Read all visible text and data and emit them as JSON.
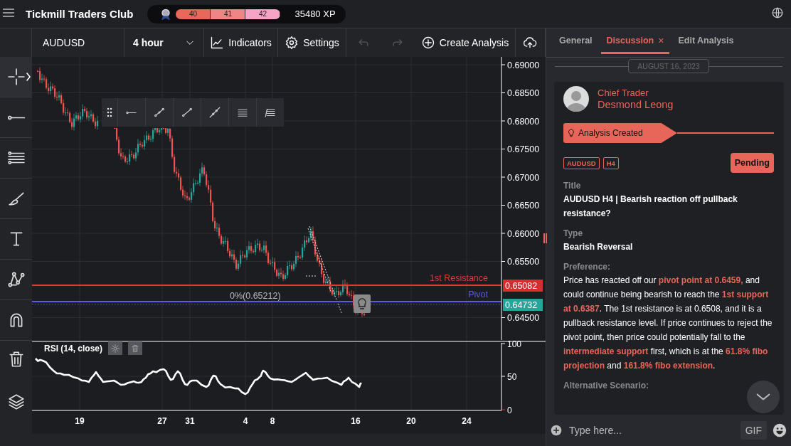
{
  "top_bar": {
    "title": "Tickmill Traders Club",
    "xp_levels": [
      {
        "label": "40",
        "color": "#e8685a"
      },
      {
        "label": "41",
        "color": "#f08585"
      },
      {
        "label": "42",
        "color": "#f6a3c6"
      }
    ],
    "xp": "35480 XP"
  },
  "left_tools": [
    {
      "kind": "crosshair",
      "selected": true
    },
    {
      "kind": "line",
      "selected": false
    },
    {
      "kind": "parallel",
      "selected": false
    },
    {
      "kind": "brush",
      "selected": false
    },
    {
      "kind": "text",
      "selected": false
    },
    {
      "kind": "pattern",
      "selected": false
    },
    {
      "kind": "magnet",
      "selected": false
    },
    {
      "kind": "trash",
      "selected": false
    },
    {
      "kind": "layers",
      "selected": false
    }
  ],
  "toolbar": {
    "symbol": "AUDUSD",
    "interval": "4 hour",
    "buttons": [
      {
        "kind": "indicators",
        "label": "Indicators"
      },
      {
        "kind": "settings",
        "label": "Settings"
      },
      {
        "kind": "undo",
        "disabled": true
      },
      {
        "kind": "redo",
        "disabled": true
      },
      {
        "kind": "create",
        "label": "Create Analysis"
      },
      {
        "kind": "upload"
      }
    ]
  },
  "drawing_toolbar": {
    "tools": [
      {
        "kind": "ray"
      },
      {
        "kind": "segment"
      },
      {
        "kind": "line"
      },
      {
        "kind": "extended"
      },
      {
        "kind": "channel"
      },
      {
        "kind": "fib"
      }
    ]
  },
  "chart": {
    "y_ticks": [
      "0.69000",
      "0.68500",
      "0.68000",
      "0.67500",
      "0.67000",
      "0.66500",
      "0.66000",
      "0.65500",
      "0.64500"
    ],
    "levels": [
      {
        "label": "1st Resistance",
        "color": "#e03a3a"
      },
      {
        "label": "Pivot",
        "color": "#5b5bdc"
      }
    ],
    "price_tags": [
      {
        "label": "0.65082",
        "color": "#d32f2f"
      },
      {
        "label": "0.64732",
        "color": "#26a69a"
      }
    ],
    "fib_label": "0%(0.65212)",
    "x_ticks": [
      "19",
      "27",
      "31",
      "4",
      "8",
      "16",
      "20",
      "24"
    ]
  },
  "rsi": {
    "title": "RSI (14, close)",
    "y_ticks": [
      "100",
      "50",
      "0"
    ]
  },
  "panel": {
    "tabs": [
      {
        "label": "General",
        "selected": false
      },
      {
        "label": "Discussion",
        "selected": true,
        "close": "×"
      },
      {
        "label": "Edit Analysis",
        "selected": false
      }
    ],
    "date": "AUGUST 16, 2023",
    "post": {
      "role": "Chief Trader",
      "author": "Desmond Leong",
      "event": "Analysis Created",
      "tags": [
        "AUDUSD",
        "H4"
      ],
      "status": "Pending",
      "fields": [
        {
          "label": "Title",
          "value": "AUDUSD H4 | Bearish reaction off pullback resistance?"
        },
        {
          "label": "Type",
          "value": "Bearish Reversal"
        },
        {
          "label": "Preference:",
          "value": "Price has reacted off our **pivot point at 0.6459,** and could continue being bearish to reach the **1st support at 0.6387**. The 1st resistance is at 0.6508, and it is a pullback resistance level. If price continues to reject the pivot point, then price could potentially fall to the **intermediate support** first, which is at the **61.8% fibo projection** and **161.8% fibo extension**."
        },
        {
          "label": "Alternative Scenario:"
        }
      ]
    },
    "composer": {
      "placeholder": "Type here...",
      "gif": "GIF"
    }
  }
}
